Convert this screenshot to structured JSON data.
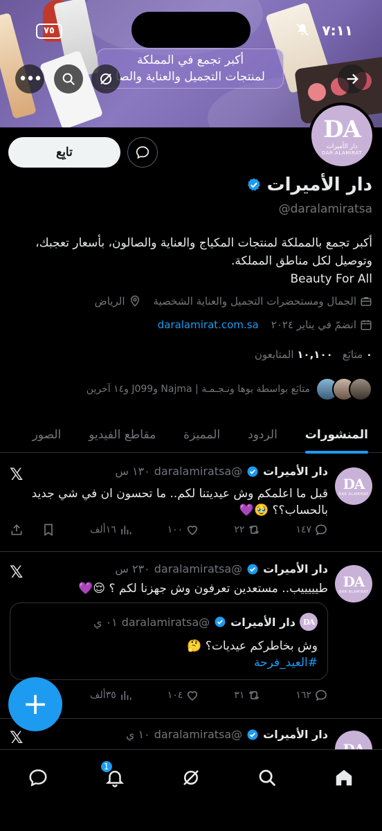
{
  "status_bar": {
    "time": "٧:١١",
    "battery": "٧٥"
  },
  "banner": {
    "text_line1": "أكبر تجمع في المملكة",
    "text_line2": "لمنتجات التجميل والعناية والصا"
  },
  "profile": {
    "avatar_text": "DA",
    "avatar_sub": "دار الأميرات",
    "avatar_sub2": "DAR ALAMIRAT",
    "name": "دار الأميرات",
    "handle": "@daralamiratsa",
    "follow_label": "تابِع",
    "bio_line1": "أكبر تجمع بالمملكة لمنتجات المكياج والعناية والصالون، بأسعار تعجبك،",
    "bio_line2": "وتوصيل لكل مناطق المملكة.",
    "bio_line3": "Beauty For All",
    "category": "الجمال ومستحضرات التجميل والعناية الشخصية",
    "location": "الرياض",
    "website": "daralamirat.com.sa",
    "joined": "انضمّ في يناير ٢٠٢٤",
    "following_count": "٠",
    "following_label": "متابَع",
    "followers_count": "١٠,١٠٠",
    "followers_label": "المتابعون",
    "known_followers": "متابَع بواسطة يوها ونـجـمـة | Najma وJ099 و١٤ آخرين"
  },
  "tabs": [
    "المنشورات",
    "الردود",
    "المميزة",
    "مقاطع الفيديو",
    "الصور"
  ],
  "tweets": [
    {
      "name": "دار الأميرات",
      "handle": "@daralamiratsa",
      "time": "١٣٠ س",
      "text_line1": "قبل ما اعلمكم وش عيديتنا لكم.. ما تحسون ان في شي جديد",
      "text_line2": "بالحساب؟؟ 🥹💜",
      "replies": "١٤٧",
      "retweets": "٢٢",
      "likes": "١٠٠",
      "views": "١٦ألف"
    },
    {
      "name": "دار الأميرات",
      "handle": "@daralamiratsa",
      "time": "٢٣٠ س",
      "text_line1": "طيييييب.. مستعدين تعرفون وش جهزنا لكم ؟ 😌💜",
      "quote_name": "دار الأميرات",
      "quote_handle": "@daralamiratsa",
      "quote_time": "٠١ ي",
      "quote_text": "وش بخاطركم عيديات؟ 🤔",
      "quote_hashtag": "#العيد_فرحة",
      "replies": "١٦٢",
      "retweets": "٣١",
      "likes": "١٠٤",
      "views": "٣٥ألف"
    },
    {
      "name": "دار الأميرات",
      "handle": "@daralamiratsa",
      "time": "١٠ ي"
    }
  ],
  "nav": {
    "notifications_badge": "1"
  },
  "colors": {
    "accent": "#1d9bf0",
    "background": "#000000",
    "avatar": "#c9b2d8"
  }
}
